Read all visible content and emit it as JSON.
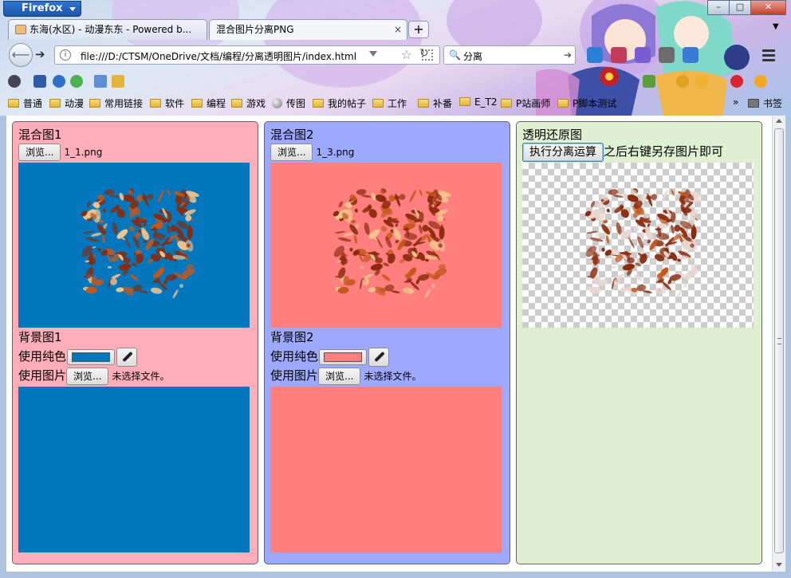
{
  "browser": {
    "menu_label": "Firefox",
    "tabs": [
      {
        "label": "东海(水区) - 动漫东东 - Powered b..."
      },
      {
        "label": "混合图片分离PNG",
        "close": "×"
      }
    ],
    "new_tab": "+",
    "url": "file:///D:/CTSM/OneDrive/文档/编程/分离透明图片/index.html",
    "search_value": "分离",
    "bookmarks": [
      "普通",
      "动漫",
      "常用链接",
      "软件",
      "编程",
      "游戏",
      "传图",
      "我的帖子",
      "工作",
      "补番",
      "E_T2",
      "P站画师",
      "P脚本测试"
    ],
    "bookmarks_more": "»",
    "bookmarks_last": "书签"
  },
  "page": {
    "panel1": {
      "title": "混合图1",
      "browse": "浏览...",
      "file": "1_1.png",
      "bg_title": "背景图1",
      "solid_label": "使用纯色",
      "color": "#0277bd",
      "image_label": "使用图片",
      "image_browse": "浏览...",
      "image_file": "未选择文件。",
      "panel_color": "#ffadb9"
    },
    "panel2": {
      "title": "混合图2",
      "browse": "浏览...",
      "file": "1_3.png",
      "bg_title": "背景图2",
      "solid_label": "使用纯色",
      "color": "#ff7f7f",
      "image_label": "使用图片",
      "image_browse": "浏览...",
      "image_file": "未选择文件。",
      "panel_color": "#9da9ff"
    },
    "panel3": {
      "title": "透明还原图",
      "run_button": "执行分离运算",
      "hint": "之后右键另存图片即可",
      "panel_color": "#dfefd1"
    }
  }
}
